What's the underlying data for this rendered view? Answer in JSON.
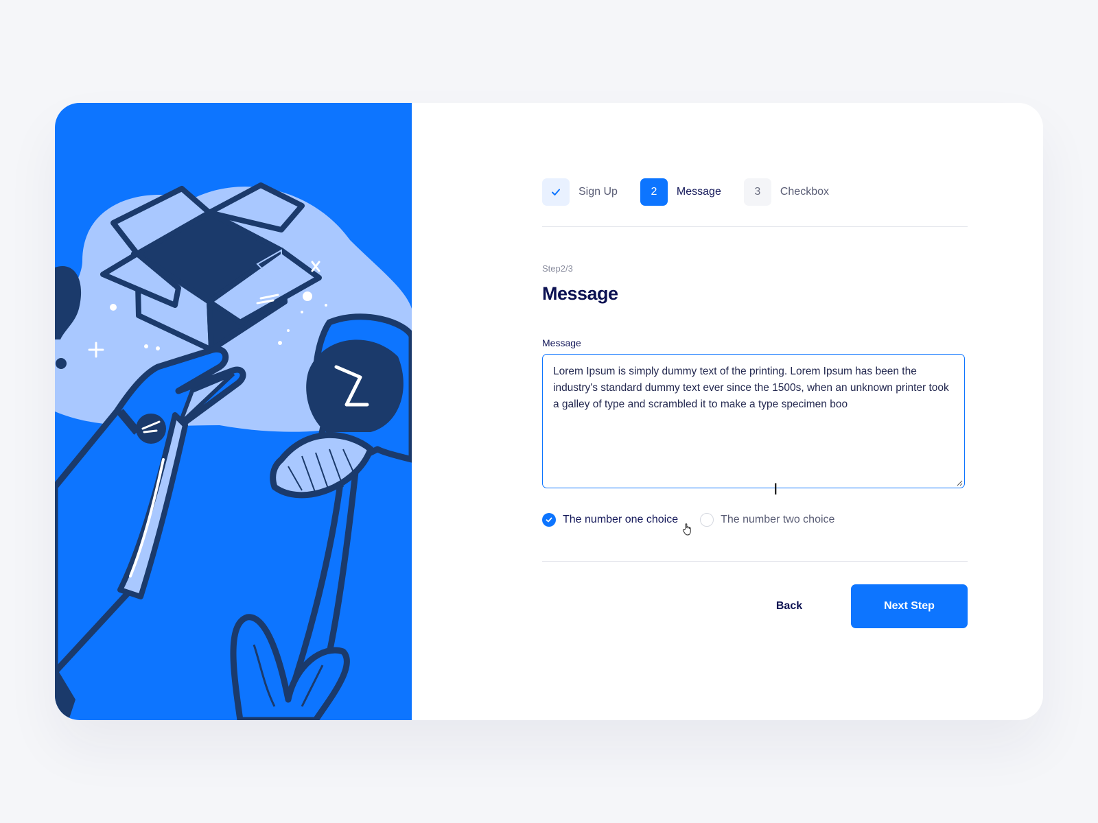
{
  "stepper": {
    "steps": [
      {
        "number": "",
        "label": "Sign Up",
        "state": "done"
      },
      {
        "number": "2",
        "label": "Message",
        "state": "active"
      },
      {
        "number": "3",
        "label": "Checkbox",
        "state": "todo"
      }
    ]
  },
  "form": {
    "step_count": "Step2/3",
    "title": "Message",
    "message_label": "Message",
    "message_value": "Lorem Ipsum is simply dummy text of the printing. Lorem Ipsum has been the industry's standard dummy text ever since the 1500s, when an unknown printer took a galley of type and scrambled it to make a type specimen boo",
    "choices": [
      {
        "label": "The number one choice",
        "selected": true
      },
      {
        "label": "The number two choice",
        "selected": false
      }
    ]
  },
  "actions": {
    "back_label": "Back",
    "next_label": "Next Step"
  },
  "colors": {
    "accent": "#0d75ff",
    "navy": "#0b1152",
    "illustration_light": "#a9c8ff",
    "illustration_dark": "#1b3a6b"
  },
  "icons": {
    "step_done": "check-icon",
    "radio_selected": "check-circle-icon",
    "cursor_text": "text-cursor-icon",
    "cursor_pointer": "hand-pointer-icon"
  }
}
